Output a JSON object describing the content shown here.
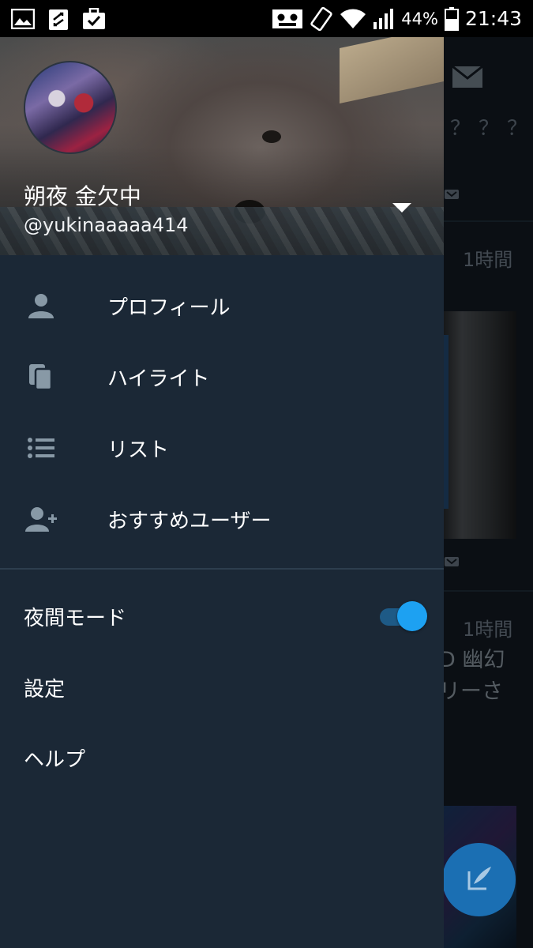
{
  "status_bar": {
    "battery_percent": "44%",
    "time": "21:43",
    "icons": [
      "image-icon",
      "clipboard-swap-icon",
      "briefcase-check-icon",
      "voicemail-icon",
      "rotate-icon",
      "wifi-icon",
      "signal-icon",
      "battery-icon"
    ]
  },
  "profile": {
    "display_name": "朔夜 金欠中",
    "handle": "@yukinaaaaa414"
  },
  "menu": {
    "items": [
      {
        "label": "プロフィール",
        "icon": "person-icon"
      },
      {
        "label": "ハイライト",
        "icon": "highlights-icon"
      },
      {
        "label": "リスト",
        "icon": "list-icon"
      },
      {
        "label": "おすすめユーザー",
        "icon": "add-user-icon"
      }
    ]
  },
  "settings": {
    "night_mode_label": "夜間モード",
    "night_mode_on": true,
    "settings_label": "設定",
    "help_label": "ヘルプ"
  },
  "timeline": {
    "question_marks": "？？？",
    "time_1": "1時間",
    "time_2": "1時間",
    "text_line_1": "D 幽幻",
    "text_line_2": "リーさ"
  },
  "colors": {
    "drawer_bg": "#1b2836",
    "accent": "#1da1f2",
    "divider": "#2d3e4e"
  }
}
